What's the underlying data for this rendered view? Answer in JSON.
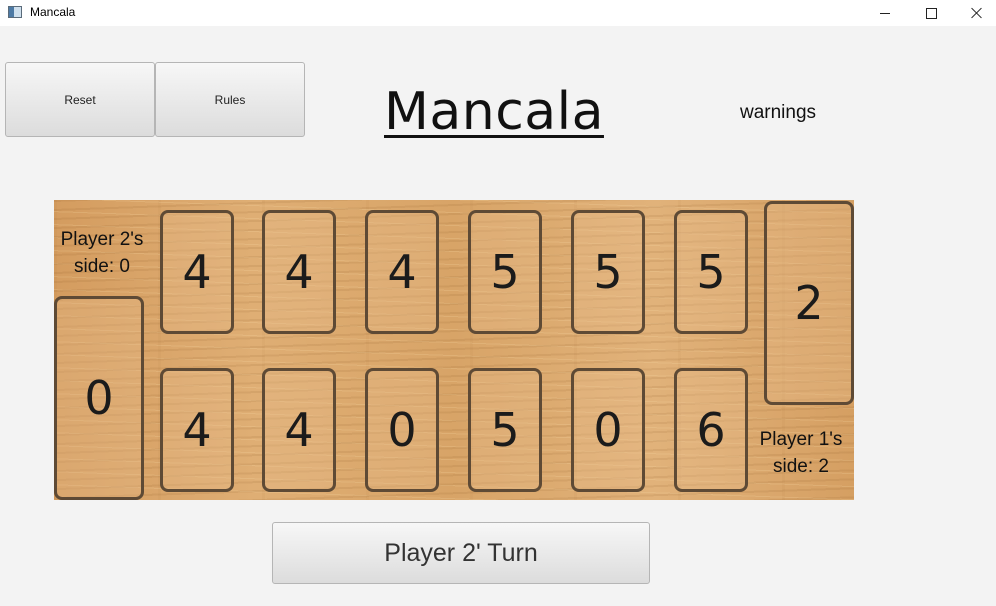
{
  "window": {
    "title": "Mancala",
    "icons": [
      "app-icon",
      "minimize-icon",
      "maximize-icon",
      "close-icon"
    ]
  },
  "toolbar": {
    "reset_label": "Reset",
    "rules_label": "Rules"
  },
  "header": {
    "title": "Mancala",
    "warnings": "warnings"
  },
  "board": {
    "player2_label_line1": "Player 2's",
    "player2_label_line2": "side: 0",
    "player1_label_line1": "Player 1's",
    "player1_label_line2": "side: 2",
    "player2_store": "0",
    "player1_store": "2",
    "top_pits": [
      "4",
      "4",
      "4",
      "5",
      "5",
      "5"
    ],
    "bottom_pits": [
      "4",
      "4",
      "0",
      "5",
      "0",
      "6"
    ],
    "colors": {
      "wood": "#dcaa6e",
      "pit_border": "#5e4a35"
    }
  },
  "turn": {
    "label": "Player 2' Turn"
  }
}
